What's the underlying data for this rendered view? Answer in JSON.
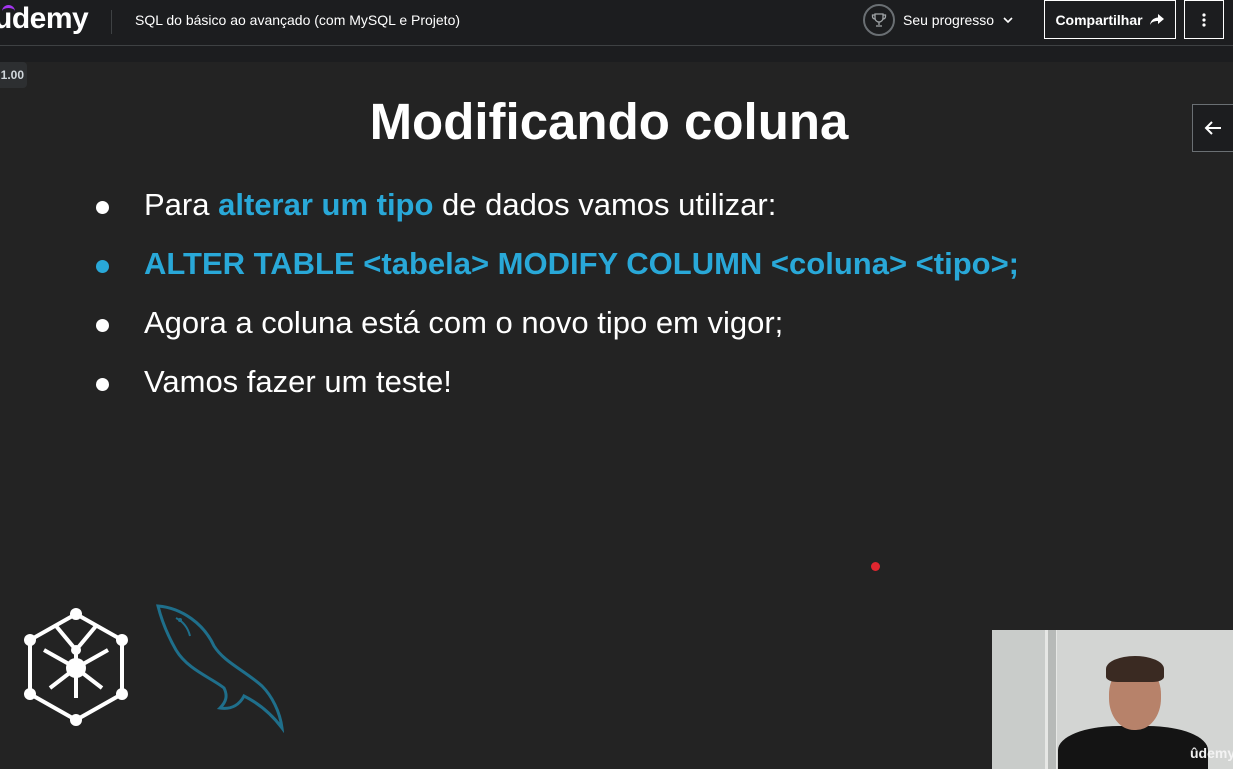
{
  "header": {
    "logo": "udemy",
    "course_title": "SQL do básico ao avançado (com MySQL e Projeto)",
    "progress_label": "Seu progresso",
    "share_label": "Compartilhar"
  },
  "player": {
    "speed": "1.00",
    "watermark": "ûdemy"
  },
  "slide": {
    "title": "Modificando coluna",
    "bullet1": {
      "before": "Para ",
      "highlight": "alterar um tipo",
      "after": " de dados vamos utilizar:"
    },
    "bullet2": "ALTER TABLE <tabela> MODIFY COLUMN <coluna> <tipo>;",
    "bullet3": "Agora a coluna está com o novo tipo em vigor;",
    "bullet4": "Vamos fazer um teste!"
  },
  "colors": {
    "accent": "#29a8d8",
    "brand": "#a435f0",
    "laser": "#e0262f",
    "background": "#1c1d1f"
  },
  "icons": [
    "trophy-icon",
    "chevron-down-icon",
    "share-icon",
    "more-vertical-icon",
    "arrow-left-icon",
    "network-cube-logo",
    "mysql-dolphin-logo"
  ]
}
